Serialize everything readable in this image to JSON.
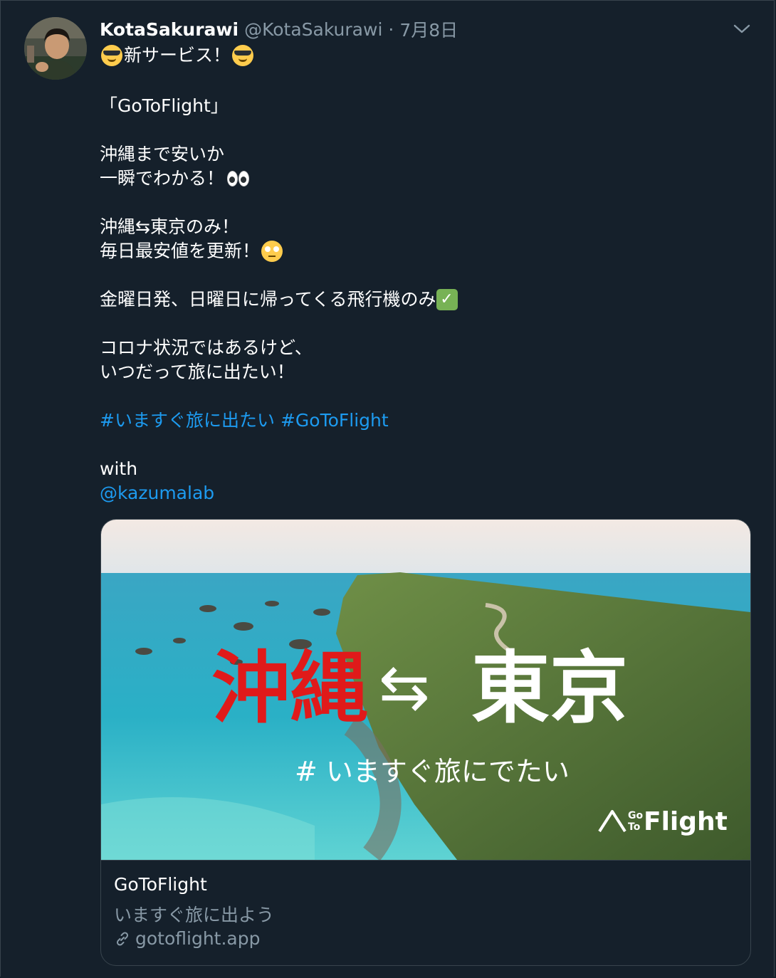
{
  "tweet": {
    "display_name": "KotaSakurawi",
    "handle": "@KotaSakurawi",
    "separator": "·",
    "date": "7月8日",
    "line1_text": "新サービス！",
    "line2": "「GoToFlight」",
    "line3": "沖縄まで安いか",
    "line4_text": "一瞬でわかる！",
    "line5": "沖縄⇆東京のみ！",
    "line6_text": "毎日最安値を更新！",
    "line7_text": "金曜日発、日曜日に帰ってくる飛行機のみ",
    "line8": "コロナ状況ではあるけど、",
    "line9": "いつだって旅に出たい！",
    "hashtag1": "#いますぐ旅に出たい",
    "hashtag2": "#GoToFlight",
    "with_text": "with",
    "mention": "@kazumalab"
  },
  "card": {
    "overlay_left": "沖縄",
    "overlay_arrow": "⇆",
    "overlay_right": "東京",
    "overlay_tag": "# いますぐ旅にでたい",
    "logo_go": "Go",
    "logo_to": "To",
    "logo_flight": "Flight",
    "title": "GoToFlight",
    "description": "いますぐ旅に出よう",
    "url": "gotoflight.app"
  },
  "icons": {
    "more": "chevron-down-icon",
    "link": "link-icon",
    "emoji_cool": "smiling-face-with-sunglasses",
    "emoji_eyes": "eyes",
    "emoji_roll": "face-with-rolling-eyes",
    "emoji_check": "white-check-mark"
  },
  "colors": {
    "background": "#15202b",
    "link": "#1d9bf0",
    "secondary_text": "#8899a6",
    "border": "#38444d",
    "overlay_red": "#e01a1a"
  }
}
